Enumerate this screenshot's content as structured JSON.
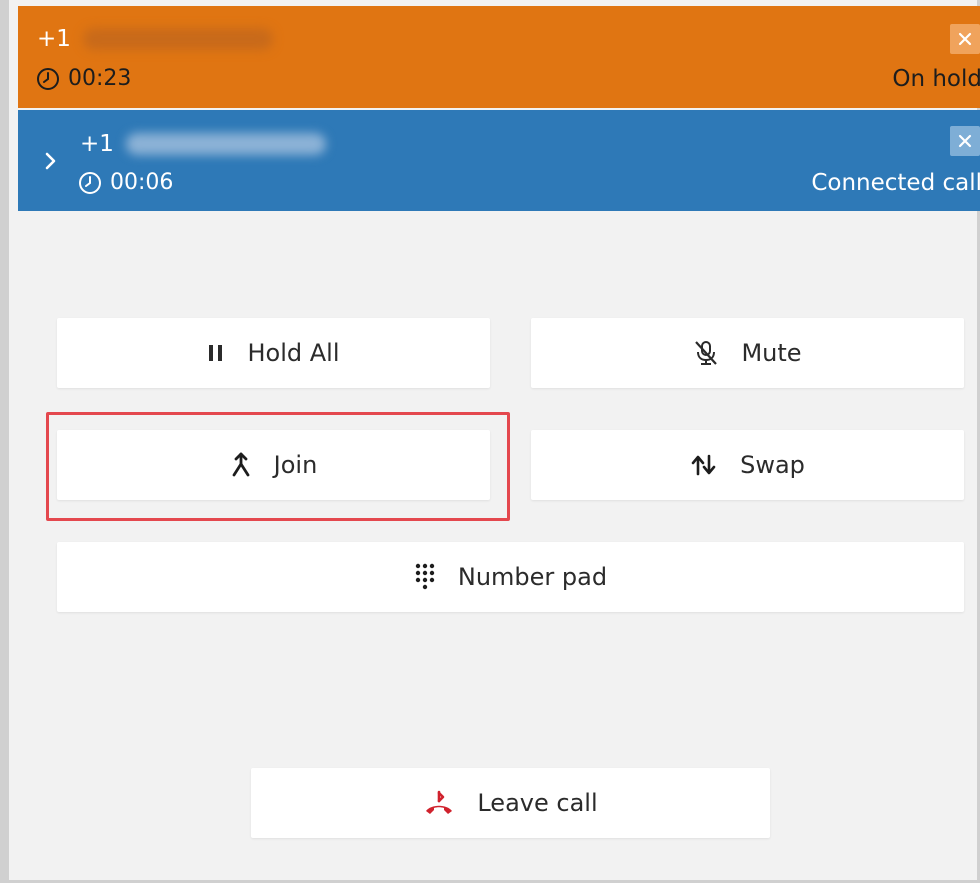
{
  "calls": {
    "on_hold": {
      "prefix": "+1",
      "timer": "00:23",
      "status": "On hold",
      "color": "#e07512"
    },
    "connected": {
      "prefix": "+1",
      "timer": "00:06",
      "status": "Connected call",
      "color": "#2e79b7"
    }
  },
  "controls": {
    "hold_all": {
      "label": "Hold All",
      "icon": "pause-icon"
    },
    "mute": {
      "label": "Mute",
      "icon": "microphone-muted-icon"
    },
    "join": {
      "label": "Join",
      "icon": "merge-icon"
    },
    "swap": {
      "label": "Swap",
      "icon": "swap-icon"
    },
    "number_pad": {
      "label": "Number pad",
      "icon": "dialpad-icon"
    },
    "leave_call": {
      "label": "Leave call",
      "icon": "leave-call-icon"
    }
  },
  "highlight_color": "#e4484e"
}
